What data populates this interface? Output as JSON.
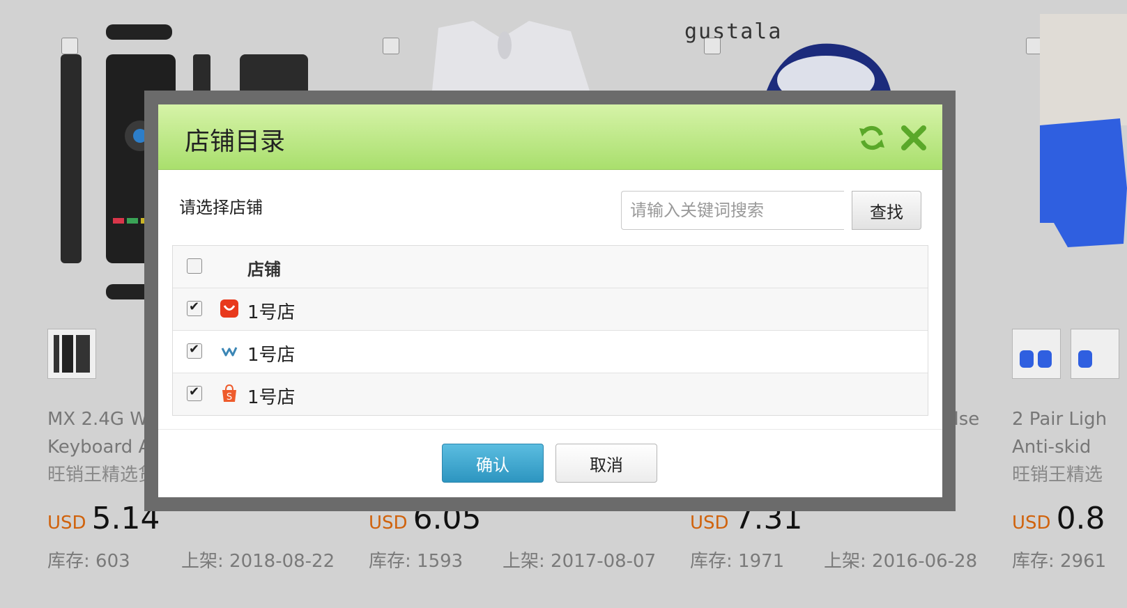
{
  "background": {
    "brand_text": "gustala",
    "products": [
      {
        "name": "MX 2.4G Wire",
        "name_line2": "Keyboard Air",
        "subtitle": "旺销王精选货源",
        "currency": "USD",
        "price": "5.14",
        "stock": "库存: 603",
        "listed": "上架: 2018-08-22"
      },
      {
        "name": "",
        "name_line2": "",
        "subtitle": "",
        "currency": "USD",
        "price": "6.05",
        "stock": "库存: 1593",
        "listed": "上架: 2017-08-07"
      },
      {
        "name": "ulse",
        "name_line2": "",
        "subtitle": "",
        "currency": "USD",
        "price": "7.31",
        "stock": "库存: 1971",
        "listed": "上架: 2016-06-28"
      },
      {
        "name": "2 Pair Ligh",
        "name_line2": "Anti-skid",
        "subtitle": "旺销王精选",
        "currency": "USD",
        "price": "0.8",
        "stock": "库存: 2961",
        "listed": ""
      }
    ]
  },
  "modal": {
    "title": "店铺目录",
    "refresh_icon": "refresh-icon",
    "close_icon": "close-icon",
    "prompt": "请选择店铺",
    "search_placeholder": "请输入关键词搜索",
    "search_button": "查找",
    "table_header": "店铺",
    "shops": [
      {
        "name": "1号店",
        "platform_icon": "aliexpress-icon",
        "checked": true
      },
      {
        "name": "1号店",
        "platform_icon": "wish-icon",
        "checked": true
      },
      {
        "name": "1号店",
        "platform_icon": "shopee-icon",
        "checked": true
      }
    ],
    "confirm_button": "确认",
    "cancel_button": "取消",
    "header_color": "#b5e47e",
    "confirm_color": "#3aa6d0"
  }
}
